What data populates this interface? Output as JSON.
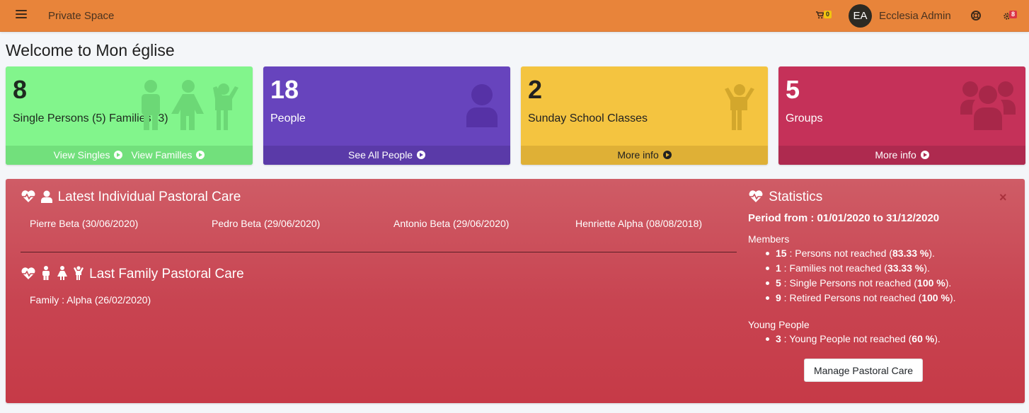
{
  "navbar": {
    "title": "Private Space",
    "cart_count": "0",
    "avatar_initials": "EA",
    "username": "Ecclesia Admin",
    "settings_count": "8",
    "background": "#e8843a"
  },
  "page_title": "Welcome to Mon église",
  "boxes": [
    {
      "number": "8",
      "label": "Single Persons (5) Families (3)",
      "links": [
        "View Singles",
        "View Familles"
      ],
      "icon": "family-icon",
      "color": "#82f58c"
    },
    {
      "number": "18",
      "label": "People",
      "links": [
        "See All People"
      ],
      "icon": "user-icon",
      "color": "#6744bd"
    },
    {
      "number": "2",
      "label": "Sunday School Classes",
      "links": [
        "More info"
      ],
      "icon": "child-icon",
      "color": "#f4c440"
    },
    {
      "number": "5",
      "label": "Groups",
      "links": [
        "More info"
      ],
      "icon": "users-icon",
      "color": "#c53159"
    }
  ],
  "pastoral": {
    "individual_title": "Latest Individual Pastoral Care",
    "individual_items": [
      "Pierre Beta (30/06/2020)",
      "Pedro Beta (29/06/2020)",
      "Antonio Beta (29/06/2020)",
      "Henriette Alpha (08/08/2018)"
    ],
    "family_title": "Last Family Pastoral Care",
    "family_items": [
      "Family : Alpha (26/02/2020)"
    ],
    "close": "×"
  },
  "statistics": {
    "title": "Statistics",
    "period": "Period from : 01/01/2020 to 31/12/2020",
    "members_label": "Members",
    "members": [
      {
        "count": "15",
        "text": " : Persons not reached (",
        "pct": "83.33 %",
        "end": ")."
      },
      {
        "count": "1",
        "text": " : Families not reached (",
        "pct": "33.33 %",
        "end": ")."
      },
      {
        "count": "5",
        "text": " : Single Persons not reached (",
        "pct": "100 %",
        "end": ")."
      },
      {
        "count": "9",
        "text": " : Retired Persons not reached (",
        "pct": "100 %",
        "end": ")."
      }
    ],
    "young_label": "Young People",
    "young": [
      {
        "count": "3",
        "text": " : Young People not reached (",
        "pct": "60 %",
        "end": ")."
      }
    ],
    "button": "Manage Pastoral Care"
  }
}
